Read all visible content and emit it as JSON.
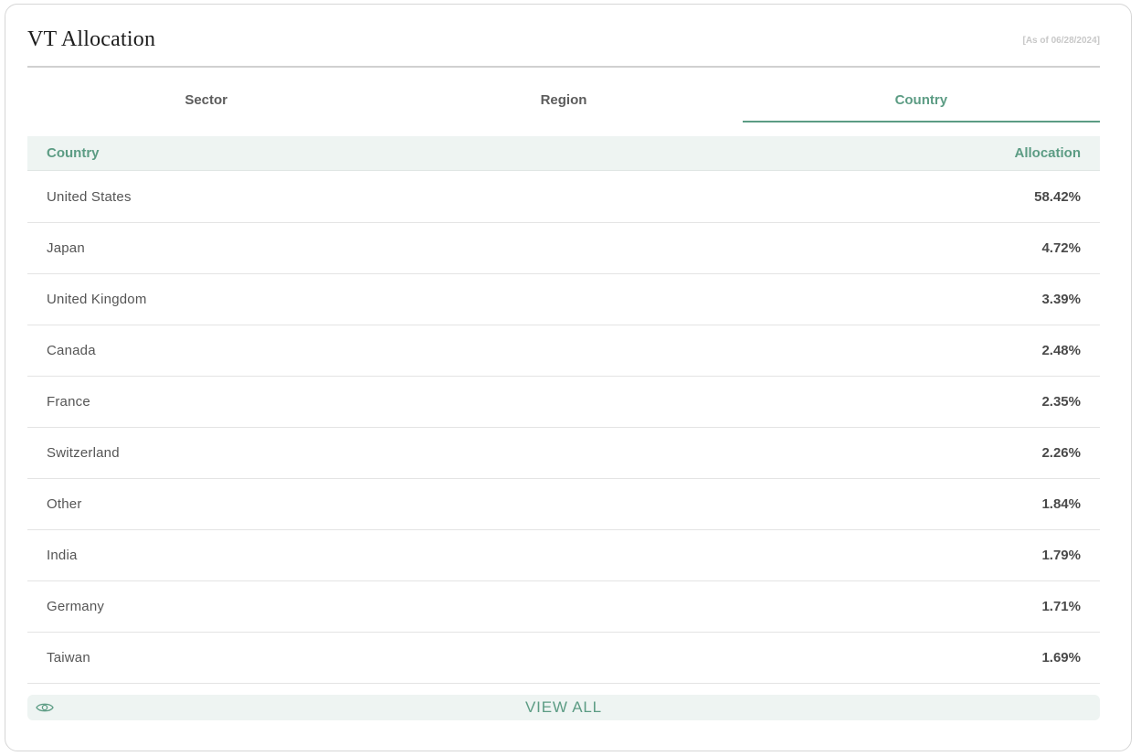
{
  "header": {
    "title": "VT Allocation",
    "as_of": "[As of 06/28/2024]"
  },
  "tabs": [
    {
      "label": "Sector",
      "active": false
    },
    {
      "label": "Region",
      "active": false
    },
    {
      "label": "Country",
      "active": true
    }
  ],
  "table": {
    "columns": {
      "country": "Country",
      "allocation": "Allocation"
    },
    "rows": [
      {
        "country": "United States",
        "allocation": "58.42%"
      },
      {
        "country": "Japan",
        "allocation": "4.72%"
      },
      {
        "country": "United Kingdom",
        "allocation": "3.39%"
      },
      {
        "country": "Canada",
        "allocation": "2.48%"
      },
      {
        "country": "France",
        "allocation": "2.35%"
      },
      {
        "country": "Switzerland",
        "allocation": "2.26%"
      },
      {
        "country": "Other",
        "allocation": "1.84%"
      },
      {
        "country": "India",
        "allocation": "1.79%"
      },
      {
        "country": "Germany",
        "allocation": "1.71%"
      },
      {
        "country": "Taiwan",
        "allocation": "1.69%"
      }
    ]
  },
  "footer": {
    "view_all_label": "VIEW ALL",
    "view_all_icon": "eye-icon"
  },
  "colors": {
    "accent": "#5c9c84",
    "header_bg": "#eef4f2"
  }
}
